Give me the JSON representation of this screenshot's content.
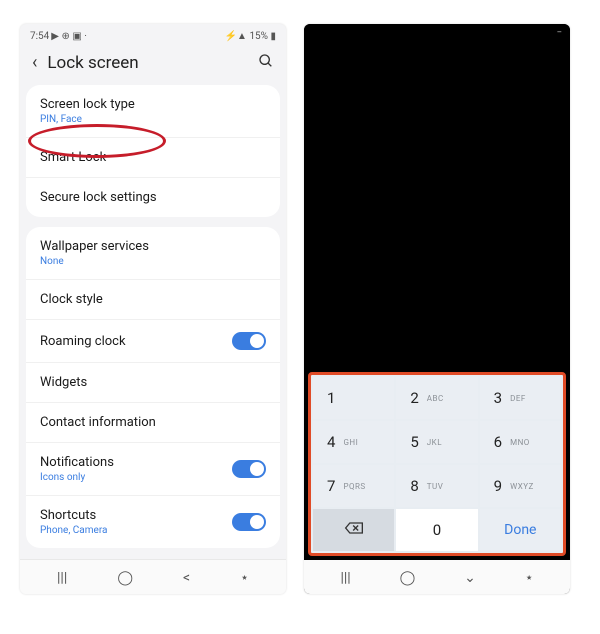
{
  "left": {
    "status": {
      "time": "7:54",
      "icons": "▶ ⊕ ▣ ·",
      "right": "⚡▲ 15% ▮"
    },
    "header": {
      "title": "Lock screen"
    },
    "sections": [
      {
        "rows": [
          {
            "label": "Screen lock type",
            "sub": "PIN, Face"
          },
          {
            "label": "Smart Lock"
          },
          {
            "label": "Secure lock settings"
          }
        ]
      },
      {
        "rows": [
          {
            "label": "Wallpaper services",
            "sub": "None"
          },
          {
            "label": "Clock style"
          },
          {
            "label": "Roaming clock",
            "toggle": true
          },
          {
            "label": "Widgets"
          },
          {
            "label": "Contact information"
          },
          {
            "label": "Notifications",
            "sub": "Icons only",
            "toggle": true
          },
          {
            "label": "Shortcuts",
            "sub": "Phone, Camera",
            "toggle": true
          }
        ]
      }
    ]
  },
  "right": {
    "keypad": {
      "keys": [
        {
          "d": "1",
          "s": ""
        },
        {
          "d": "2",
          "s": "ABC"
        },
        {
          "d": "3",
          "s": "DEF"
        },
        {
          "d": "4",
          "s": "GHI"
        },
        {
          "d": "5",
          "s": "JKL"
        },
        {
          "d": "6",
          "s": "MNO"
        },
        {
          "d": "7",
          "s": "PQRS"
        },
        {
          "d": "8",
          "s": "TUV"
        },
        {
          "d": "9",
          "s": "WXYZ"
        }
      ],
      "zero": "0",
      "done": "Done"
    }
  },
  "nav": {
    "recents": "|||",
    "home": "◯",
    "back_left": "<",
    "accessibility": "⋆",
    "back_down": "⌄"
  }
}
